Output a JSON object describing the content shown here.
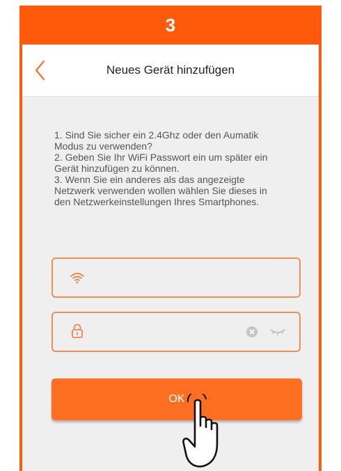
{
  "step": {
    "number": "3"
  },
  "header": {
    "title": "Neues Gerät hinzufügen",
    "back_icon": "chevron-left-icon"
  },
  "instructions": {
    "line1": "1. Sind Sie sicher ein 2.4Ghz oder den Aumatik\nModus zu verwenden?",
    "line2": "2. Geben Sie Ihr WiFi Passwort ein um später ein\nGerät hinzufügen zu können.",
    "line3": "3. Wenn Sie ein anderes als das angezeigte\nNetzwerk verwenden wollen wählen Sie dieses in\nden Netzwerkeinstellungen Ihres Smartphones."
  },
  "wifi_field": {
    "value": "",
    "icon": "wifi-icon"
  },
  "password_field": {
    "value": "",
    "icons": [
      "lock-icon",
      "clear-icon",
      "eye-closed-icon"
    ]
  },
  "ok_button": {
    "label": "OK"
  },
  "colors": {
    "accent": "#ff5a0a",
    "button": "#ff6f21",
    "field_border": "#f08f52",
    "background": "#efeff0"
  }
}
